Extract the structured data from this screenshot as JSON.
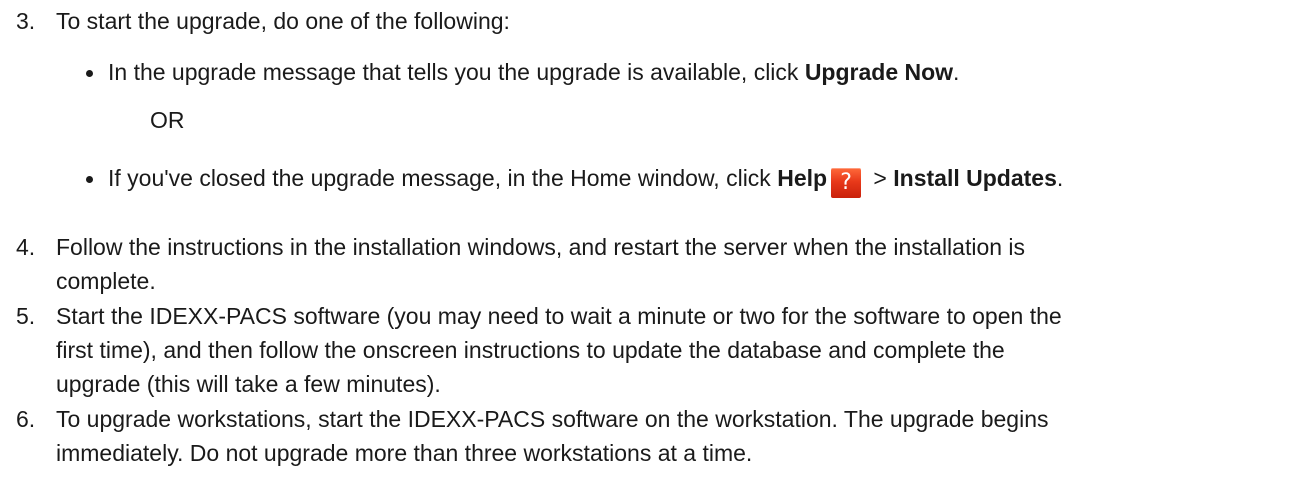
{
  "steps": [
    {
      "number": "3.",
      "text": "To start the upgrade, do one of the following:",
      "bullets": [
        {
          "prefix": "In the upgrade message that tells you the upgrade is available, click ",
          "bold": "Upgrade Now",
          "suffix": "."
        },
        {
          "prefix": "If you've closed the upgrade message, in the Home window, click ",
          "bold_help": "Help",
          "icon": "help-question-icon",
          "icon_glyph": "?",
          "separator": " > ",
          "bold_action": "Install Updates",
          "suffix": "."
        }
      ],
      "or_label": "OR"
    },
    {
      "number": "4.",
      "lines": [
        "Follow the instructions in the installation windows, and restart the server when the installation is",
        "complete."
      ]
    },
    {
      "number": "5.",
      "lines": [
        "Start the IDEXX-PACS software (you may need to wait a minute or two for the software to open the",
        "first time), and then follow the onscreen instructions to update the database and complete the",
        "upgrade (this will take a few minutes)."
      ]
    },
    {
      "number": "6.",
      "lines": [
        "To upgrade workstations, start the IDEXX-PACS software on the workstation. The upgrade begins",
        "immediately. Do not upgrade more than three workstations at a time."
      ]
    }
  ],
  "colors": {
    "text": "#1a1a1a",
    "help_icon_bg": "#e8391a"
  }
}
